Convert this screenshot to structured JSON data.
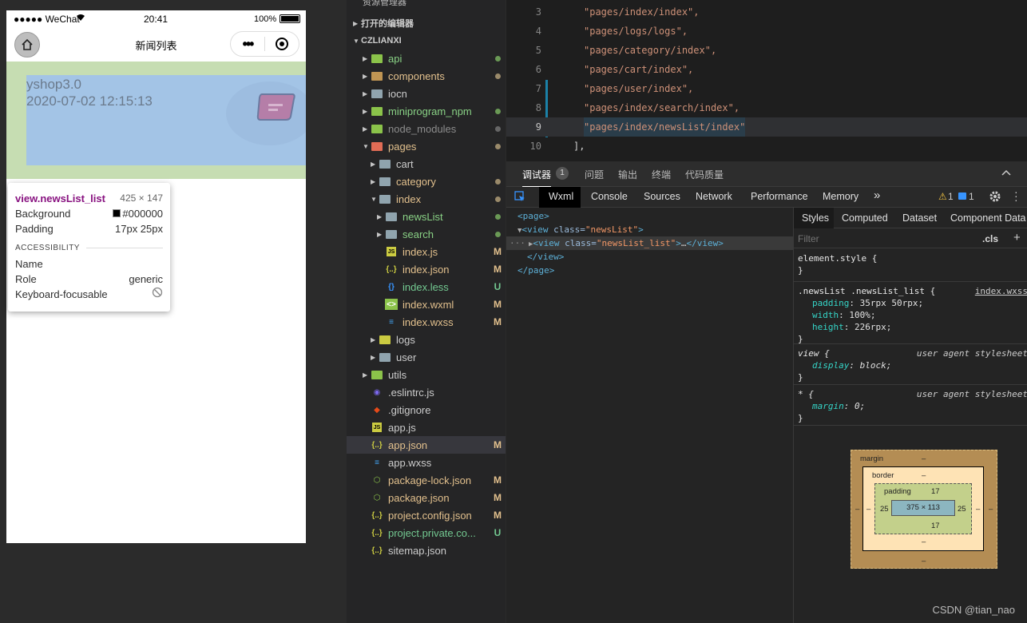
{
  "simulator": {
    "status": {
      "carrier": "●●●●● WeChat",
      "time": "20:41",
      "battery": "100%"
    },
    "nav": {
      "title": "新闻列表",
      "more": "•••"
    },
    "item": {
      "title": "yshop3.0",
      "date": "2020-07-02 12:15:13"
    },
    "tooltip": {
      "selector": "view.newsList_list",
      "size": "425 × 147",
      "background_label": "Background",
      "background_value": "#000000",
      "padding_label": "Padding",
      "padding_value": "17px 25px",
      "accessibility": "ACCESSIBILITY",
      "name_label": "Name",
      "role_label": "Role",
      "role_value": "generic",
      "focus_label": "Keyboard-focusable"
    }
  },
  "explorer": {
    "header": "资源管理器",
    "open_editors": "打开的编辑器",
    "project": "CZLIANXI",
    "items": [
      {
        "label": "api",
        "kind": "folder-green",
        "depth": 1,
        "arrow": "▶",
        "status": "dot-green",
        "color": "#89d185"
      },
      {
        "label": "components",
        "kind": "folder",
        "depth": 1,
        "arrow": "▶",
        "status": "dot-yellow",
        "color": "#e2c08d"
      },
      {
        "label": "iocn",
        "kind": "folder-grey",
        "depth": 1,
        "arrow": "▶",
        "status": "",
        "color": "#cccccc"
      },
      {
        "label": "miniprogram_npm",
        "kind": "folder-green",
        "depth": 1,
        "arrow": "▶",
        "status": "dot-green",
        "color": "#89d185"
      },
      {
        "label": "node_modules",
        "kind": "folder-green",
        "depth": 1,
        "arrow": "▶",
        "status": "dot-grey",
        "color": "#8c8c8c"
      },
      {
        "label": "pages",
        "kind": "folder-red",
        "depth": 1,
        "arrow": "▼",
        "status": "dot-yellow",
        "color": "#e2c08d"
      },
      {
        "label": "cart",
        "kind": "folder-grey",
        "depth": 2,
        "arrow": "▶",
        "status": "",
        "color": "#cccccc"
      },
      {
        "label": "category",
        "kind": "folder-grey",
        "depth": 2,
        "arrow": "▶",
        "status": "dot-yellow",
        "color": "#e2c08d"
      },
      {
        "label": "index",
        "kind": "folder-grey",
        "depth": 2,
        "arrow": "▼",
        "status": "dot-yellow",
        "color": "#e2c08d"
      },
      {
        "label": "newsList",
        "kind": "folder-grey",
        "depth": 3,
        "arrow": "▶",
        "status": "dot-green",
        "color": "#89d185"
      },
      {
        "label": "search",
        "kind": "folder-grey",
        "depth": 3,
        "arrow": "▶",
        "status": "dot-green",
        "color": "#89d185"
      },
      {
        "label": "index.js",
        "kind": "js",
        "depth": 3,
        "arrow": "",
        "status": "M",
        "color": "#e2c08d"
      },
      {
        "label": "index.json",
        "kind": "json",
        "depth": 3,
        "arrow": "",
        "status": "M",
        "color": "#e2c08d"
      },
      {
        "label": "index.less",
        "kind": "less",
        "depth": 3,
        "arrow": "",
        "status": "U",
        "color": "#73c991"
      },
      {
        "label": "index.wxml",
        "kind": "wxml",
        "depth": 3,
        "arrow": "",
        "status": "M",
        "color": "#e2c08d"
      },
      {
        "label": "index.wxss",
        "kind": "css",
        "depth": 3,
        "arrow": "",
        "status": "M",
        "color": "#e2c08d"
      },
      {
        "label": "logs",
        "kind": "folder-yellow",
        "depth": 2,
        "arrow": "▶",
        "status": "",
        "color": "#cccccc"
      },
      {
        "label": "user",
        "kind": "folder-grey",
        "depth": 2,
        "arrow": "▶",
        "status": "",
        "color": "#cccccc"
      },
      {
        "label": "utils",
        "kind": "folder-green",
        "depth": 1,
        "arrow": "▶",
        "status": "",
        "color": "#cccccc"
      },
      {
        "label": ".eslintrc.js",
        "kind": "eslint",
        "depth": 1,
        "arrow": "",
        "status": "",
        "color": "#cccccc"
      },
      {
        "label": ".gitignore",
        "kind": "git",
        "depth": 1,
        "arrow": "",
        "status": "",
        "color": "#cccccc"
      },
      {
        "label": "app.js",
        "kind": "js",
        "depth": 1,
        "arrow": "",
        "status": "",
        "color": "#cccccc"
      },
      {
        "label": "app.json",
        "kind": "json",
        "depth": 1,
        "arrow": "",
        "status": "M",
        "color": "#e2c08d",
        "selected": true
      },
      {
        "label": "app.wxss",
        "kind": "css",
        "depth": 1,
        "arrow": "",
        "status": "",
        "color": "#cccccc"
      },
      {
        "label": "package-lock.json",
        "kind": "node",
        "depth": 1,
        "arrow": "",
        "status": "M",
        "color": "#e2c08d"
      },
      {
        "label": "package.json",
        "kind": "node",
        "depth": 1,
        "arrow": "",
        "status": "M",
        "color": "#e2c08d"
      },
      {
        "label": "project.config.json",
        "kind": "json",
        "depth": 1,
        "arrow": "",
        "status": "M",
        "color": "#e2c08d"
      },
      {
        "label": "project.private.co...",
        "kind": "json",
        "depth": 1,
        "arrow": "",
        "status": "U",
        "color": "#73c991"
      },
      {
        "label": "sitemap.json",
        "kind": "json",
        "depth": 1,
        "arrow": "",
        "status": "",
        "color": "#cccccc"
      }
    ]
  },
  "editor": {
    "lines": [
      {
        "n": "3",
        "code": "\"pages/index/index\","
      },
      {
        "n": "4",
        "code": "\"pages/logs/logs\","
      },
      {
        "n": "5",
        "code": "\"pages/category/index\","
      },
      {
        "n": "6",
        "code": "\"pages/cart/index\","
      },
      {
        "n": "7",
        "code": "\"pages/user/index\","
      },
      {
        "n": "8",
        "code": "\"pages/index/search/index\","
      },
      {
        "n": "9",
        "code": "\"pages/index/newsList/index\"",
        "active": true
      },
      {
        "n": "10",
        "code": "],"
      }
    ]
  },
  "devtools": {
    "top_tabs": [
      "调试器",
      "问题",
      "输出",
      "终端",
      "代码质量"
    ],
    "debugger_count": "1",
    "panel_tabs": [
      "Wxml",
      "Console",
      "Sources",
      "Network",
      "Performance",
      "Memory"
    ],
    "more": "»",
    "warn_count": "1",
    "info_count": "1",
    "wxml": {
      "page_open": "page",
      "view_tag": "view",
      "class_attr": "class",
      "view_class": "\"newsList\"",
      "list_class": "\"newsList_list\"",
      "ellipsis": "…",
      "gutter": "···"
    },
    "styles": {
      "tabs": [
        "Styles",
        "Computed",
        "Dataset",
        "Component Data"
      ],
      "filter_placeholder": "Filter",
      "cls": ".cls",
      "plus": "+",
      "rules": [
        {
          "selector": "element.style {",
          "source": "",
          "props": []
        },
        {
          "selector": ".newsList .newsList_list {",
          "source": "index.wxss",
          "source_link": true,
          "props": [
            {
              "name": "padding",
              "value": "35rpx 50rpx;"
            },
            {
              "name": "width",
              "value": "100%;"
            },
            {
              "name": "height",
              "value": "226rpx;"
            }
          ]
        },
        {
          "selector": "view {",
          "source": "user agent stylesheet",
          "italic": true,
          "props": [
            {
              "name": "display",
              "value": "block;"
            }
          ]
        },
        {
          "selector": "* {",
          "source": "user agent stylesheet",
          "italic": true,
          "props": [
            {
              "name": "margin",
              "value": "0;"
            }
          ]
        }
      ]
    },
    "box_model": {
      "margin_label": "margin",
      "margin_top": "–",
      "margin_bottom": "–",
      "margin_left": "–",
      "margin_right": "–",
      "border_label": "border",
      "border_top": "–",
      "border_bottom": "–",
      "border_left": "–",
      "border_right": "–",
      "padding_label": "padding",
      "padding_top": "17",
      "padding_bottom": "17",
      "padding_left": "25",
      "padding_right": "25",
      "content": "375 × 113"
    }
  },
  "credit": "CSDN @tian_nao",
  "colors": {
    "selection_line": "#2f3033",
    "active_tab": "#1e1e1e",
    "accent_blue": "#3794ff"
  }
}
